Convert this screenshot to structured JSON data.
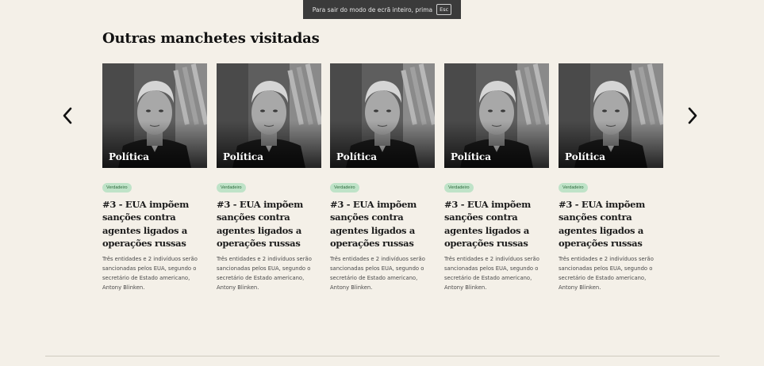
{
  "fullscreen_notice": {
    "text": "Para sair do modo de ecrã inteiro, prima",
    "key": "Esc"
  },
  "section": {
    "title": "Outras manchetes visitadas"
  },
  "carousel": {
    "prev_icon": "chevron-left-icon",
    "next_icon": "chevron-right-icon"
  },
  "cards": [
    {
      "category": "Política",
      "badge": "Verdadeiro",
      "headline": "#3 - EUA impõem sanções contra agentes ligados a operações russas",
      "description": "Três entidades e 2 indivíduos serão sancionadas pelos EUA, segundo o secretário de Estado americano, Antony Blinken."
    },
    {
      "category": "Política",
      "badge": "Verdadeiro",
      "headline": "#3 - EUA impõem sanções contra agentes ligados a operações russas",
      "description": "Três entidades e 2 indivíduos serão sancionadas pelos EUA, segundo o secretário de Estado americano, Antony Blinken."
    },
    {
      "category": "Política",
      "badge": "Verdadeiro",
      "headline": "#3 - EUA impõem sanções contra agentes ligados a operações russas",
      "description": "Três entidades e 2 indivíduos serão sancionadas pelos EUA, segundo o secretário de Estado americano, Antony Blinken."
    },
    {
      "category": "Política",
      "badge": "Verdadeiro",
      "headline": "#3 - EUA impõem sanções contra agentes ligados a operações russas",
      "description": "Três entidades e 2 indivíduos serão sancionadas pelos EUA, segundo o secretário de Estado americano, Antony Blinken."
    },
    {
      "category": "Política",
      "badge": "Verdadeiro",
      "headline": "#3 - EUA impõem sanções contra agentes ligados a operações russas",
      "description": "Três entidades e 2 indivíduos serão sancionadas pelos EUA, segundo o secretário de Estado americano, Antony Blinken."
    }
  ],
  "colors": {
    "background": "#f4f0e8",
    "badge_bg": "#bfe3c8",
    "badge_text": "#2c6a3b"
  }
}
